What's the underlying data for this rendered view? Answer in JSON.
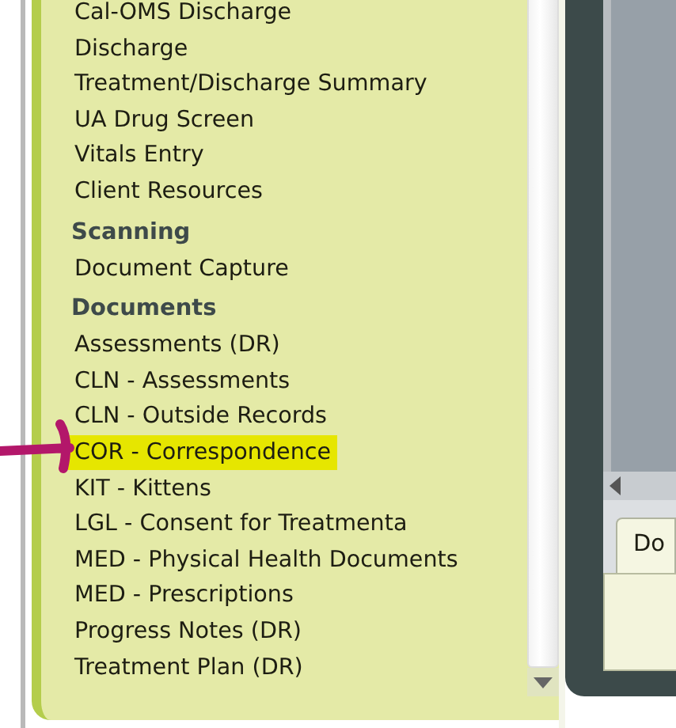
{
  "navigation": {
    "sections": [
      {
        "items": [
          {
            "label": "Cal-OMS Discharge",
            "selected": false
          },
          {
            "label": "Discharge",
            "selected": false
          },
          {
            "label": "Treatment/Discharge Summary",
            "selected": false
          },
          {
            "label": "UA Drug Screen",
            "selected": false
          },
          {
            "label": "Vitals Entry",
            "selected": false
          },
          {
            "label": "Client Resources",
            "selected": false
          }
        ]
      },
      {
        "heading": "Scanning",
        "items": [
          {
            "label": "Document Capture",
            "selected": false
          }
        ]
      },
      {
        "heading": "Documents",
        "items": [
          {
            "label": "Assessments (DR)",
            "selected": false
          },
          {
            "label": "CLN - Assessments",
            "selected": false
          },
          {
            "label": "CLN - Outside Records",
            "selected": false
          },
          {
            "label": "COR - Correspondence",
            "selected": true
          },
          {
            "label": "KIT - Kittens",
            "selected": false
          },
          {
            "label": "LGL - Consent for Treatmenta",
            "selected": false
          },
          {
            "label": "MED - Physical Health Documents",
            "selected": false
          },
          {
            "label": "MED - Prescriptions",
            "selected": false
          },
          {
            "label": "Progress Notes (DR)",
            "selected": false
          },
          {
            "label": "Treatment Plan (DR)",
            "selected": false
          }
        ]
      }
    ]
  },
  "side_panel": {
    "tabs": [
      {
        "label": "Do",
        "selected": true
      }
    ]
  }
}
